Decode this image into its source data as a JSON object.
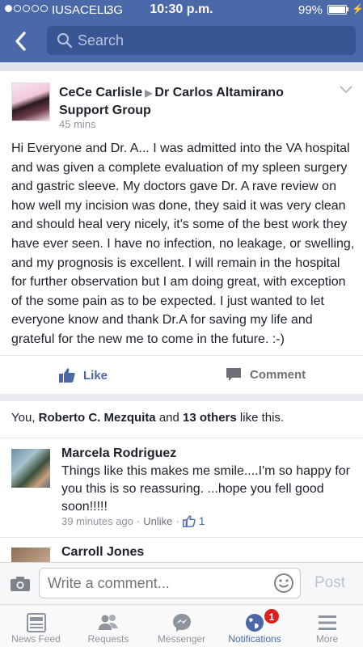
{
  "status_bar": {
    "carrier": "IUSACELL",
    "network": "3G",
    "time": "10:30 p.m.",
    "battery_percent": "99%",
    "battery_level": 0.99,
    "signal_bars_filled": 1,
    "signal_bars_total": 5
  },
  "header": {
    "search_placeholder": "Search",
    "icons": [
      "back-chevron-icon",
      "search-icon"
    ],
    "color": "#4b69a8"
  },
  "post": {
    "author": "CeCe Carlisle",
    "group": "Dr Carlos Altamirano Support Group",
    "time": "45 mins",
    "body": "Hi Everyone and Dr. A... I was admitted into the VA hospital and was given a complete evaluation of my spleen surgery and gastric sleeve. My doctors gave Dr. A rave review on how well my incision was done, they said it was very clean and should heal very nicely, it's some of the best work they have ever seen. I have no infection, no leakage, or swelling, and my prognosis is excellent. I will remain in the hospital for further observation but I am doing great, with exception of the some pain as to be expected. I  just wanted to let everyone know and thank Dr.A for saving my life and grateful for the new me to come in the future. :-)",
    "like_label": "Like",
    "comment_label": "Comment"
  },
  "likes": {
    "prefix": "You, ",
    "person": "Roberto C. Mezquita",
    "middle": " and ",
    "others": "13 others",
    "suffix": " like this."
  },
  "comments": [
    {
      "name": "Marcela Rodriguez",
      "text": "Things like this makes me smile....I'm so happy for you this is so reassuring. ...hope you fell good soon!!!!!",
      "time": "39 minutes ago",
      "sep": "·",
      "unlike": "Unlike",
      "like_count": "1"
    },
    {
      "name": "Carroll Jones"
    }
  ],
  "composer": {
    "placeholder": "Write a comment...",
    "post_label": "Post"
  },
  "tabs": [
    {
      "label": "News Feed",
      "icon": "news-feed-icon"
    },
    {
      "label": "Requests",
      "icon": "friend-requests-icon"
    },
    {
      "label": "Messenger",
      "icon": "messenger-icon"
    },
    {
      "label": "Notifications",
      "icon": "globe-icon",
      "badge": "1"
    },
    {
      "label": "More",
      "icon": "menu-icon"
    }
  ]
}
